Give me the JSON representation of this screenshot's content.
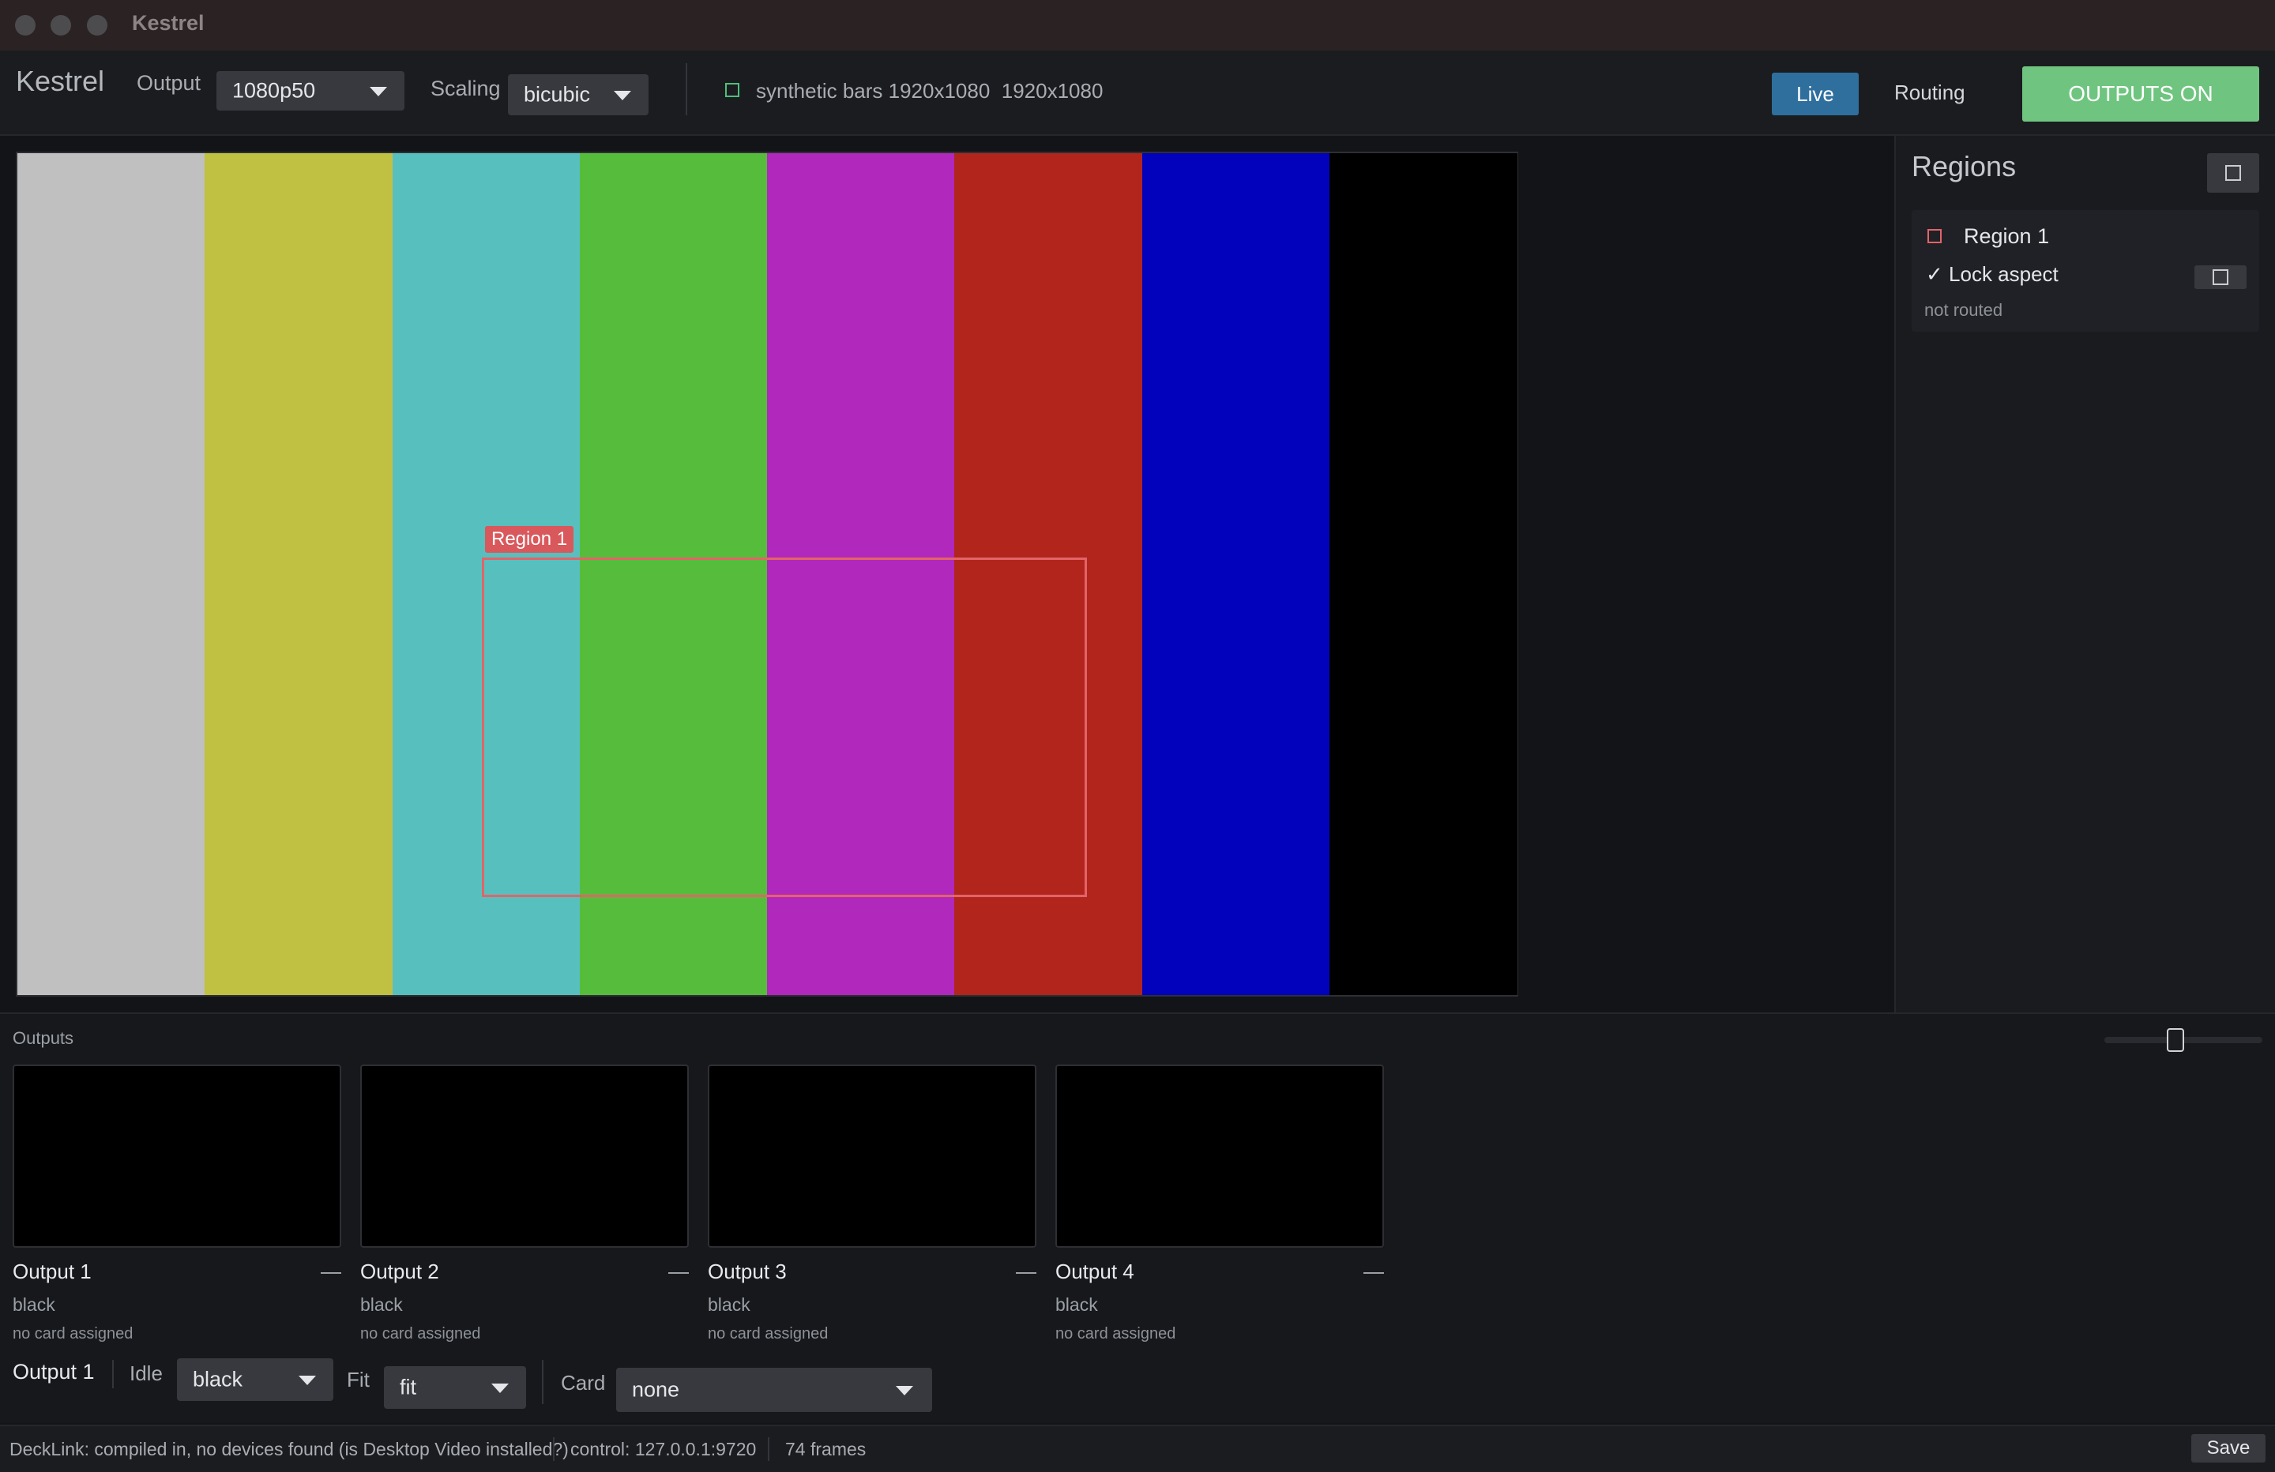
{
  "window": {
    "title": "Kestrel"
  },
  "toolbar": {
    "app_name": "Kestrel",
    "output_label": "Output",
    "output_value": "1080p50",
    "scaling_label": "Scaling",
    "scaling_value": "bicubic",
    "source_text": "synthetic bars 1920x1080  1920x1080",
    "live_label": "Live",
    "routing_label": "Routing",
    "outputs_on_label": "OUTPUTS ON",
    "colors": {
      "live": "#2f6f9e",
      "outputs_on": "#6fc57f"
    }
  },
  "preview": {
    "bar_colors": [
      "#c0c0c0",
      "#c0c042",
      "#58bfbf",
      "#56bc3c",
      "#b028bc",
      "#b2251c",
      "#0202bc",
      "#000000"
    ],
    "region_tag": "Region 1",
    "region_color": "#e26468"
  },
  "regions": {
    "title": "Regions",
    "items": [
      {
        "name": "Region 1",
        "lock_label": "Lock aspect",
        "lock_checked": true,
        "route_status": "not routed"
      }
    ]
  },
  "outputs": {
    "title": "Outputs",
    "cards": [
      {
        "name": "Output 1",
        "source": "black",
        "card": "no card assigned"
      },
      {
        "name": "Output 2",
        "source": "black",
        "card": "no card assigned"
      },
      {
        "name": "Output 3",
        "source": "black",
        "card": "no card assigned"
      },
      {
        "name": "Output 4",
        "source": "black",
        "card": "no card assigned"
      }
    ],
    "editor": {
      "selected": "Output 1",
      "idle_label": "Idle",
      "idle_value": "black",
      "fit_label": "Fit",
      "fit_value": "fit",
      "card_label": "Card",
      "card_value": "none"
    }
  },
  "status": {
    "decklink": "DeckLink: compiled in, no devices found (is Desktop Video installed?)",
    "control": "control: 127.0.0.1:9720",
    "frames": "74 frames",
    "save_label": "Save"
  }
}
